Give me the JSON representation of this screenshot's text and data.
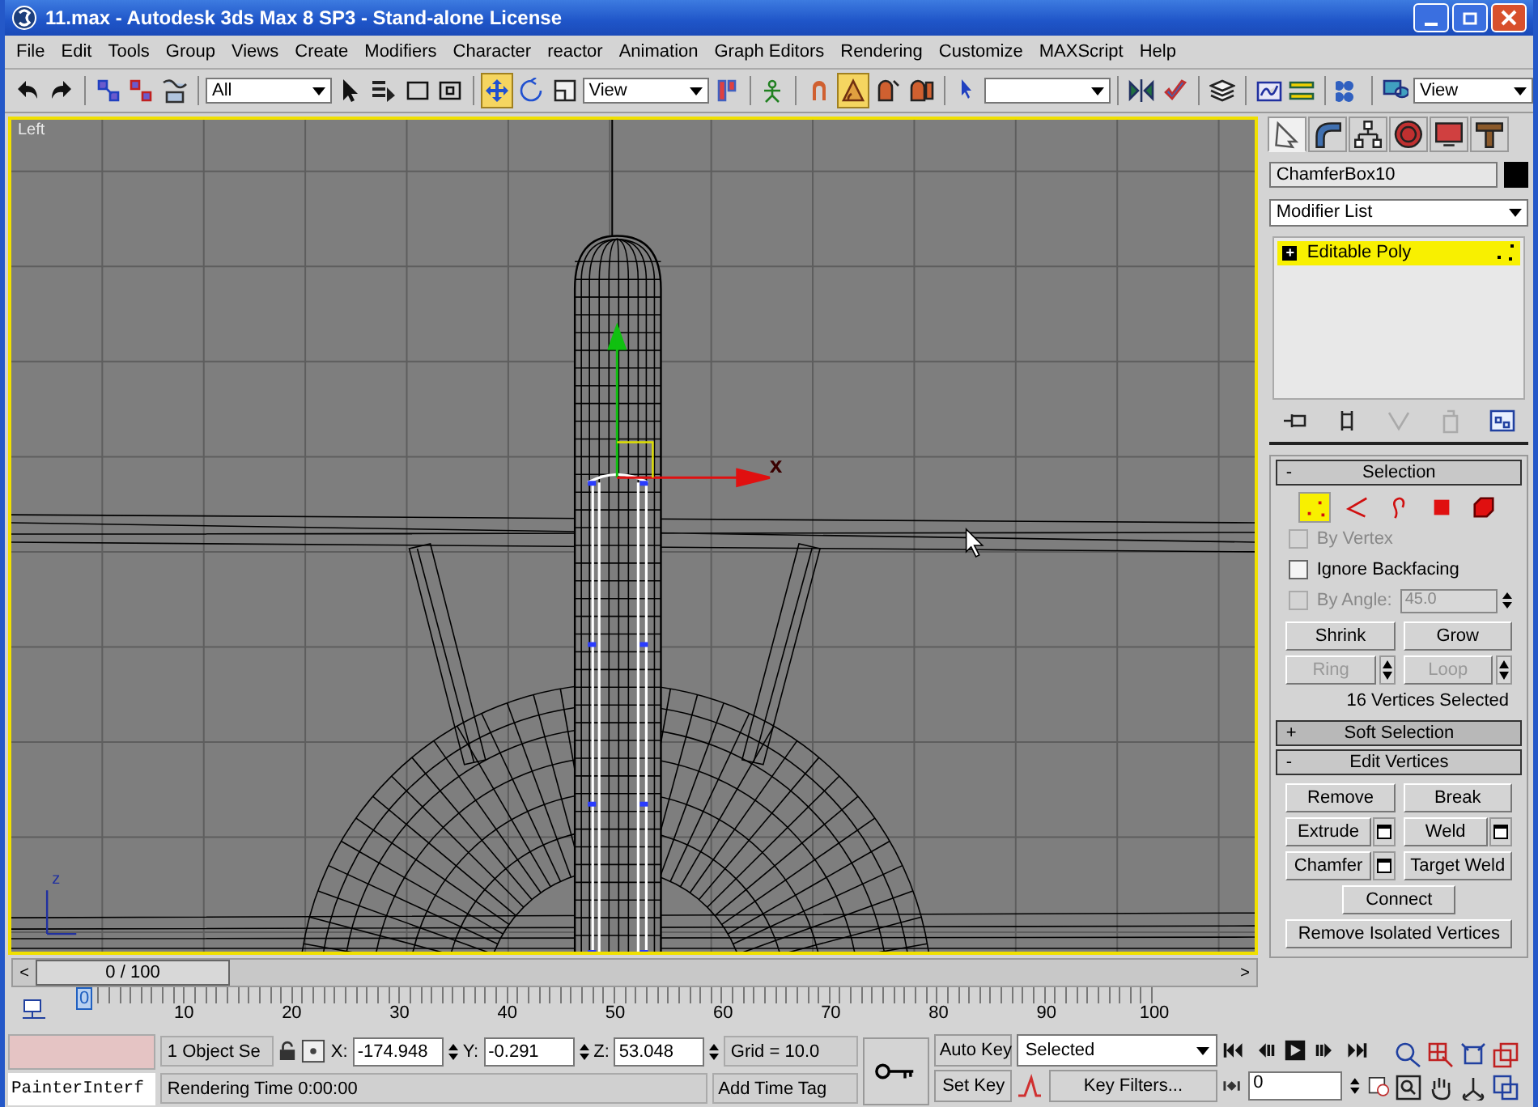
{
  "window": {
    "title": "11.max - Autodesk 3ds Max 8 SP3  - Stand-alone License"
  },
  "menu": [
    "File",
    "Edit",
    "Tools",
    "Group",
    "Views",
    "Create",
    "Modifiers",
    "Character",
    "reactor",
    "Animation",
    "Graph Editors",
    "Rendering",
    "Customize",
    "MAXScript",
    "Help"
  ],
  "toolbar": [
    {
      "kind": "button",
      "selected": false
    },
    {
      "kind": "button",
      "selected": false
    },
    {
      "kind": "separator"
    },
    {
      "kind": "button",
      "selected": false
    },
    {
      "kind": "button",
      "selected": false
    },
    {
      "kind": "button",
      "selected": false
    },
    {
      "kind": "separator"
    },
    {
      "kind": "dropdown",
      "value": "All"
    },
    {
      "kind": "button",
      "selected": false
    },
    {
      "kind": "button",
      "selected": false
    },
    {
      "kind": "button",
      "selected": false
    },
    {
      "kind": "button",
      "selected": false
    },
    {
      "kind": "separator"
    },
    {
      "kind": "button",
      "selected": true
    },
    {
      "kind": "button",
      "selected": false
    },
    {
      "kind": "button",
      "selected": false
    },
    {
      "kind": "dropdown",
      "value": "View"
    },
    {
      "kind": "button",
      "selected": false
    },
    {
      "kind": "separator"
    },
    {
      "kind": "button",
      "selected": false
    },
    {
      "kind": "separator"
    },
    {
      "kind": "button",
      "selected": false
    },
    {
      "kind": "button",
      "selected": true
    },
    {
      "kind": "button",
      "selected": false
    },
    {
      "kind": "button",
      "selected": false
    },
    {
      "kind": "separator"
    },
    {
      "kind": "button",
      "selected": false
    },
    {
      "kind": "dropdown"
    },
    {
      "kind": "separator"
    },
    {
      "kind": "button",
      "selected": false
    },
    {
      "kind": "button",
      "selected": false
    },
    {
      "kind": "separator"
    },
    {
      "kind": "button",
      "selected": false
    },
    {
      "kind": "separator"
    },
    {
      "kind": "button",
      "selected": false
    },
    {
      "kind": "button",
      "selected": false
    },
    {
      "kind": "separator"
    },
    {
      "kind": "button",
      "selected": false
    },
    {
      "kind": "separator"
    },
    {
      "kind": "button",
      "selected": false
    },
    {
      "kind": "dropdown",
      "value": "View"
    }
  ],
  "viewport": {
    "label": "Left",
    "gizmo_x": "x",
    "axis_z": "z"
  },
  "command_panel": {
    "tabs": [
      {
        "selected": true
      },
      {
        "selected": false
      },
      {
        "selected": false
      },
      {
        "selected": false
      },
      {
        "selected": false
      },
      {
        "selected": false
      }
    ],
    "object_name": "ChamferBox10",
    "modifier_list": "Modifier List",
    "stack": [
      {
        "sign": "+",
        "label": "Editable Poly",
        "selected": true
      }
    ],
    "rollouts": [
      {
        "sign": "-",
        "title": "Selection",
        "expanded": true
      },
      {
        "sign": "+",
        "title": "Soft Selection",
        "expanded": false
      },
      {
        "sign": "-",
        "title": "Edit Vertices",
        "expanded": true
      }
    ],
    "subobjects": [
      {
        "selected": true
      },
      {
        "selected": false
      },
      {
        "selected": false
      },
      {
        "selected": false
      },
      {
        "selected": false
      }
    ],
    "options": [
      {
        "label": "By Vertex",
        "checked": false,
        "disabled": true
      },
      {
        "label": "Ignore Backfacing",
        "checked": false,
        "disabled": false
      },
      {
        "label": "By Angle:",
        "checked": false,
        "disabled": true,
        "value": "45.0"
      }
    ],
    "selection_buttons": [
      {
        "label": "Shrink",
        "disabled": false,
        "kind": "plain"
      },
      {
        "label": "Grow",
        "disabled": false,
        "kind": "plain"
      },
      {
        "label": "Ring",
        "disabled": true,
        "kind": "spinner"
      },
      {
        "label": "Loop",
        "disabled": true,
        "kind": "spinner"
      }
    ],
    "selection_status": "16 Vertices Selected",
    "edit_buttons": [
      {
        "label": "Remove",
        "kind": "half"
      },
      {
        "label": "Break",
        "kind": "half"
      },
      {
        "label": "Extrude",
        "kind": "settings"
      },
      {
        "label": "Weld",
        "kind": "settings"
      },
      {
        "label": "Chamfer",
        "kind": "settings"
      },
      {
        "label": "Target Weld",
        "kind": "half"
      },
      {
        "label": "Connect",
        "kind": "center"
      },
      {
        "label": "Remove Isolated Vertices",
        "kind": "full"
      }
    ]
  },
  "time_slider": {
    "prev": "<",
    "frame": "0 / 100",
    "next": ">",
    "level": 0
  },
  "track": {
    "ticks": [
      "0",
      "10",
      "20",
      "30",
      "40",
      "50",
      "60",
      "70",
      "80",
      "90",
      "100"
    ]
  },
  "status": {
    "listener": "PainterInterf",
    "selection": "1 Object Se",
    "coords": [
      {
        "axis": "X:",
        "value": "-174.948"
      },
      {
        "axis": "Y:",
        "value": "-0.291"
      },
      {
        "axis": "Z:",
        "value": "53.048"
      }
    ],
    "grid": "Grid = 10.0",
    "prompt": "Rendering Time  0:00:00",
    "add_time_tag": "Add Time Tag"
  },
  "animation": {
    "auto_key": "Auto Key",
    "set_key": "Set Key",
    "key_mode": "Selected",
    "key_filters": "Key Filters...",
    "current_frame": "0"
  }
}
